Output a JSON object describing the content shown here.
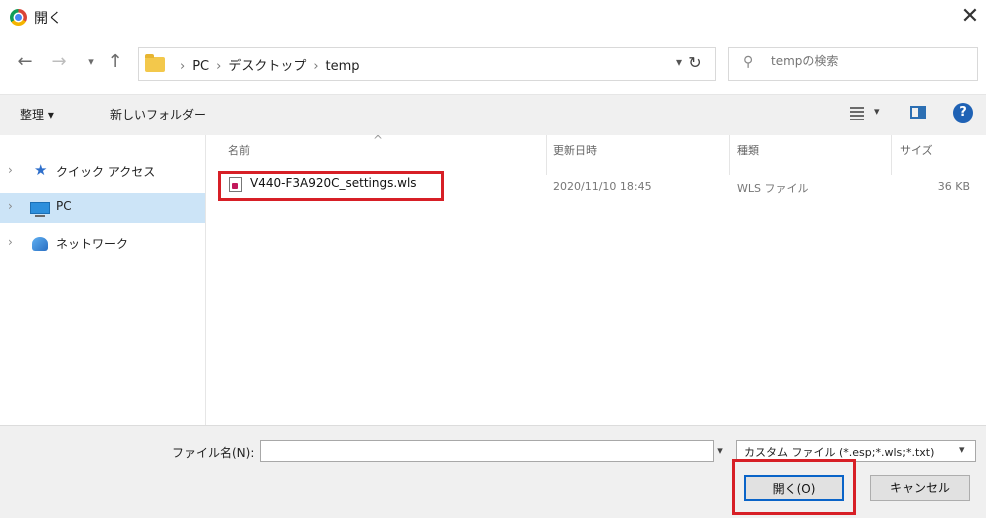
{
  "window": {
    "title": "開く"
  },
  "address": {
    "crumbs": [
      "PC",
      "デスクトップ",
      "temp"
    ],
    "dropdown_icon": "chevron-down-icon",
    "refresh_icon": "refresh-icon"
  },
  "search": {
    "placeholder": "tempの検索"
  },
  "toolbar": {
    "organize_label": "整理 ▾",
    "new_folder_label": "新しいフォルダー"
  },
  "sidebar": {
    "items": [
      {
        "label": "クイック アクセス",
        "icon": "star-icon"
      },
      {
        "label": "PC",
        "icon": "pc-icon",
        "selected": true
      },
      {
        "label": "ネットワーク",
        "icon": "network-icon"
      }
    ]
  },
  "columns": {
    "name": "名前",
    "date": "更新日時",
    "type": "種類",
    "size": "サイズ"
  },
  "files": [
    {
      "name": "V440-F3A920C_settings.wls",
      "date": "2020/11/10 18:45",
      "type": "WLS ファイル",
      "size": "36 KB"
    }
  ],
  "footer": {
    "filename_label": "ファイル名(N):",
    "filename_value": "",
    "filetype_value": "カスタム ファイル (*.esp;*.wls;*.txt)",
    "open_label": "開く(O)",
    "cancel_label": "キャンセル"
  },
  "colors": {
    "highlight": "#d71f26",
    "selection": "#cce4f7",
    "accent": "#0a64c8"
  }
}
